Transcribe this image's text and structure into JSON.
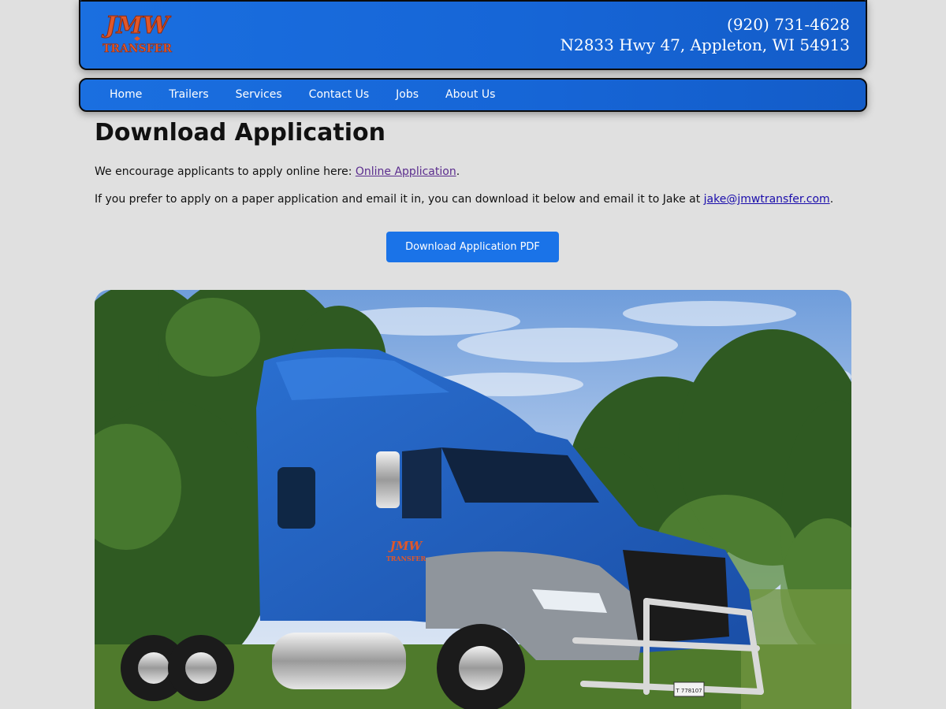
{
  "header": {
    "logo_text_top": "JMW",
    "logo_text_bottom": "TRANSFER",
    "phone": "(920) 731-4628",
    "address": "N2833 Hwy 47, Appleton, WI 54913"
  },
  "nav": {
    "items": [
      {
        "label": "Home"
      },
      {
        "label": "Trailers"
      },
      {
        "label": "Services"
      },
      {
        "label": "Contact Us"
      },
      {
        "label": "Jobs"
      },
      {
        "label": "About Us"
      }
    ]
  },
  "main": {
    "title": "Download Application",
    "p1_text": "We encourage applicants to apply online here: ",
    "p1_link": "Online Application",
    "p1_end": ".",
    "p2_text": "If you prefer to apply on a paper application and email it in, you can download it below and email it to Jake at ",
    "p2_link": "jake@jmwtransfer.com",
    "p2_end": ".",
    "download_button": "Download Application PDF"
  },
  "photo": {
    "plate_text": "T 778107"
  },
  "colors": {
    "brand_blue": "#1a6fe0",
    "button_blue": "#1a73e8",
    "logo_orange": "#e0572a",
    "page_bg": "#e0e0e0"
  }
}
